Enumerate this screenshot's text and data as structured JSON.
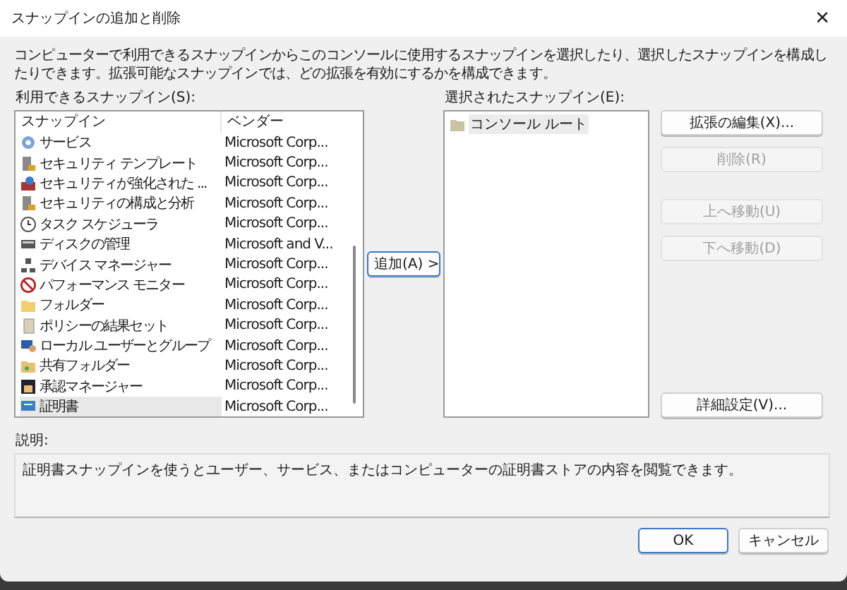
{
  "window": {
    "title": "スナップインの追加と削除",
    "close": "✕"
  },
  "intro": "コンピューターで利用できるスナップインからこのコンソールに使用するスナップインを選択したり、選択したスナップインを構成したりできます。拡張可能なスナップインでは、どの拡張を有効にするかを構成できます。",
  "available": {
    "label": "利用できるスナップイン(S):",
    "columns": [
      "スナップイン",
      "ベンダー"
    ],
    "rows": [
      {
        "name": "サービス",
        "vendor": "Microsoft Corp...",
        "selected": false
      },
      {
        "name": "セキュリティ テンプレート",
        "vendor": "Microsoft Corp...",
        "selected": false
      },
      {
        "name": "セキュリティが強化された ...",
        "vendor": "Microsoft Corp...",
        "selected": false
      },
      {
        "name": "セキュリティの構成と分析",
        "vendor": "Microsoft Corp...",
        "selected": false
      },
      {
        "name": "タスク スケジューラ",
        "vendor": "Microsoft Corp...",
        "selected": false
      },
      {
        "name": "ディスクの管理",
        "vendor": "Microsoft and V...",
        "selected": false
      },
      {
        "name": "デバイス マネージャー",
        "vendor": "Microsoft Corp...",
        "selected": false
      },
      {
        "name": "パフォーマンス モニター",
        "vendor": "Microsoft Corp...",
        "selected": false
      },
      {
        "name": "フォルダー",
        "vendor": "Microsoft Corp...",
        "selected": false
      },
      {
        "name": "ポリシーの結果セット",
        "vendor": "Microsoft Corp...",
        "selected": false
      },
      {
        "name": "ローカル ユーザーとグループ",
        "vendor": "Microsoft Corp...",
        "selected": false
      },
      {
        "name": "共有フォルダー",
        "vendor": "Microsoft Corp...",
        "selected": false
      },
      {
        "name": "承認マネージャー",
        "vendor": "Microsoft Corp...",
        "selected": false
      },
      {
        "name": "証明書",
        "vendor": "Microsoft Corp...",
        "selected": true
      }
    ]
  },
  "add_button": "追加(A) >",
  "selected_snapins": {
    "label": "選択されたスナップイン(E):",
    "items": [
      {
        "name": "コンソール ルート",
        "selected": true
      }
    ]
  },
  "side_button_groups": [
    [
      {
        "label": "拡張の編集(X)...",
        "disabled": false
      },
      {
        "label": "削除(R)",
        "disabled": true
      }
    ],
    [
      {
        "label": "上へ移動(U)",
        "disabled": true
      },
      {
        "label": "下へ移動(D)",
        "disabled": true
      }
    ]
  ],
  "advanced_button": "詳細設定(V)...",
  "description": {
    "label": "説明:",
    "text": "証明書スナップインを使うとユーザー、サービス、またはコンピューターの証明書ストアの内容を閲覧できます。"
  },
  "footer_buttons": [
    {
      "label": "OK",
      "primary": true
    },
    {
      "label": "キャンセル",
      "primary": false
    }
  ]
}
